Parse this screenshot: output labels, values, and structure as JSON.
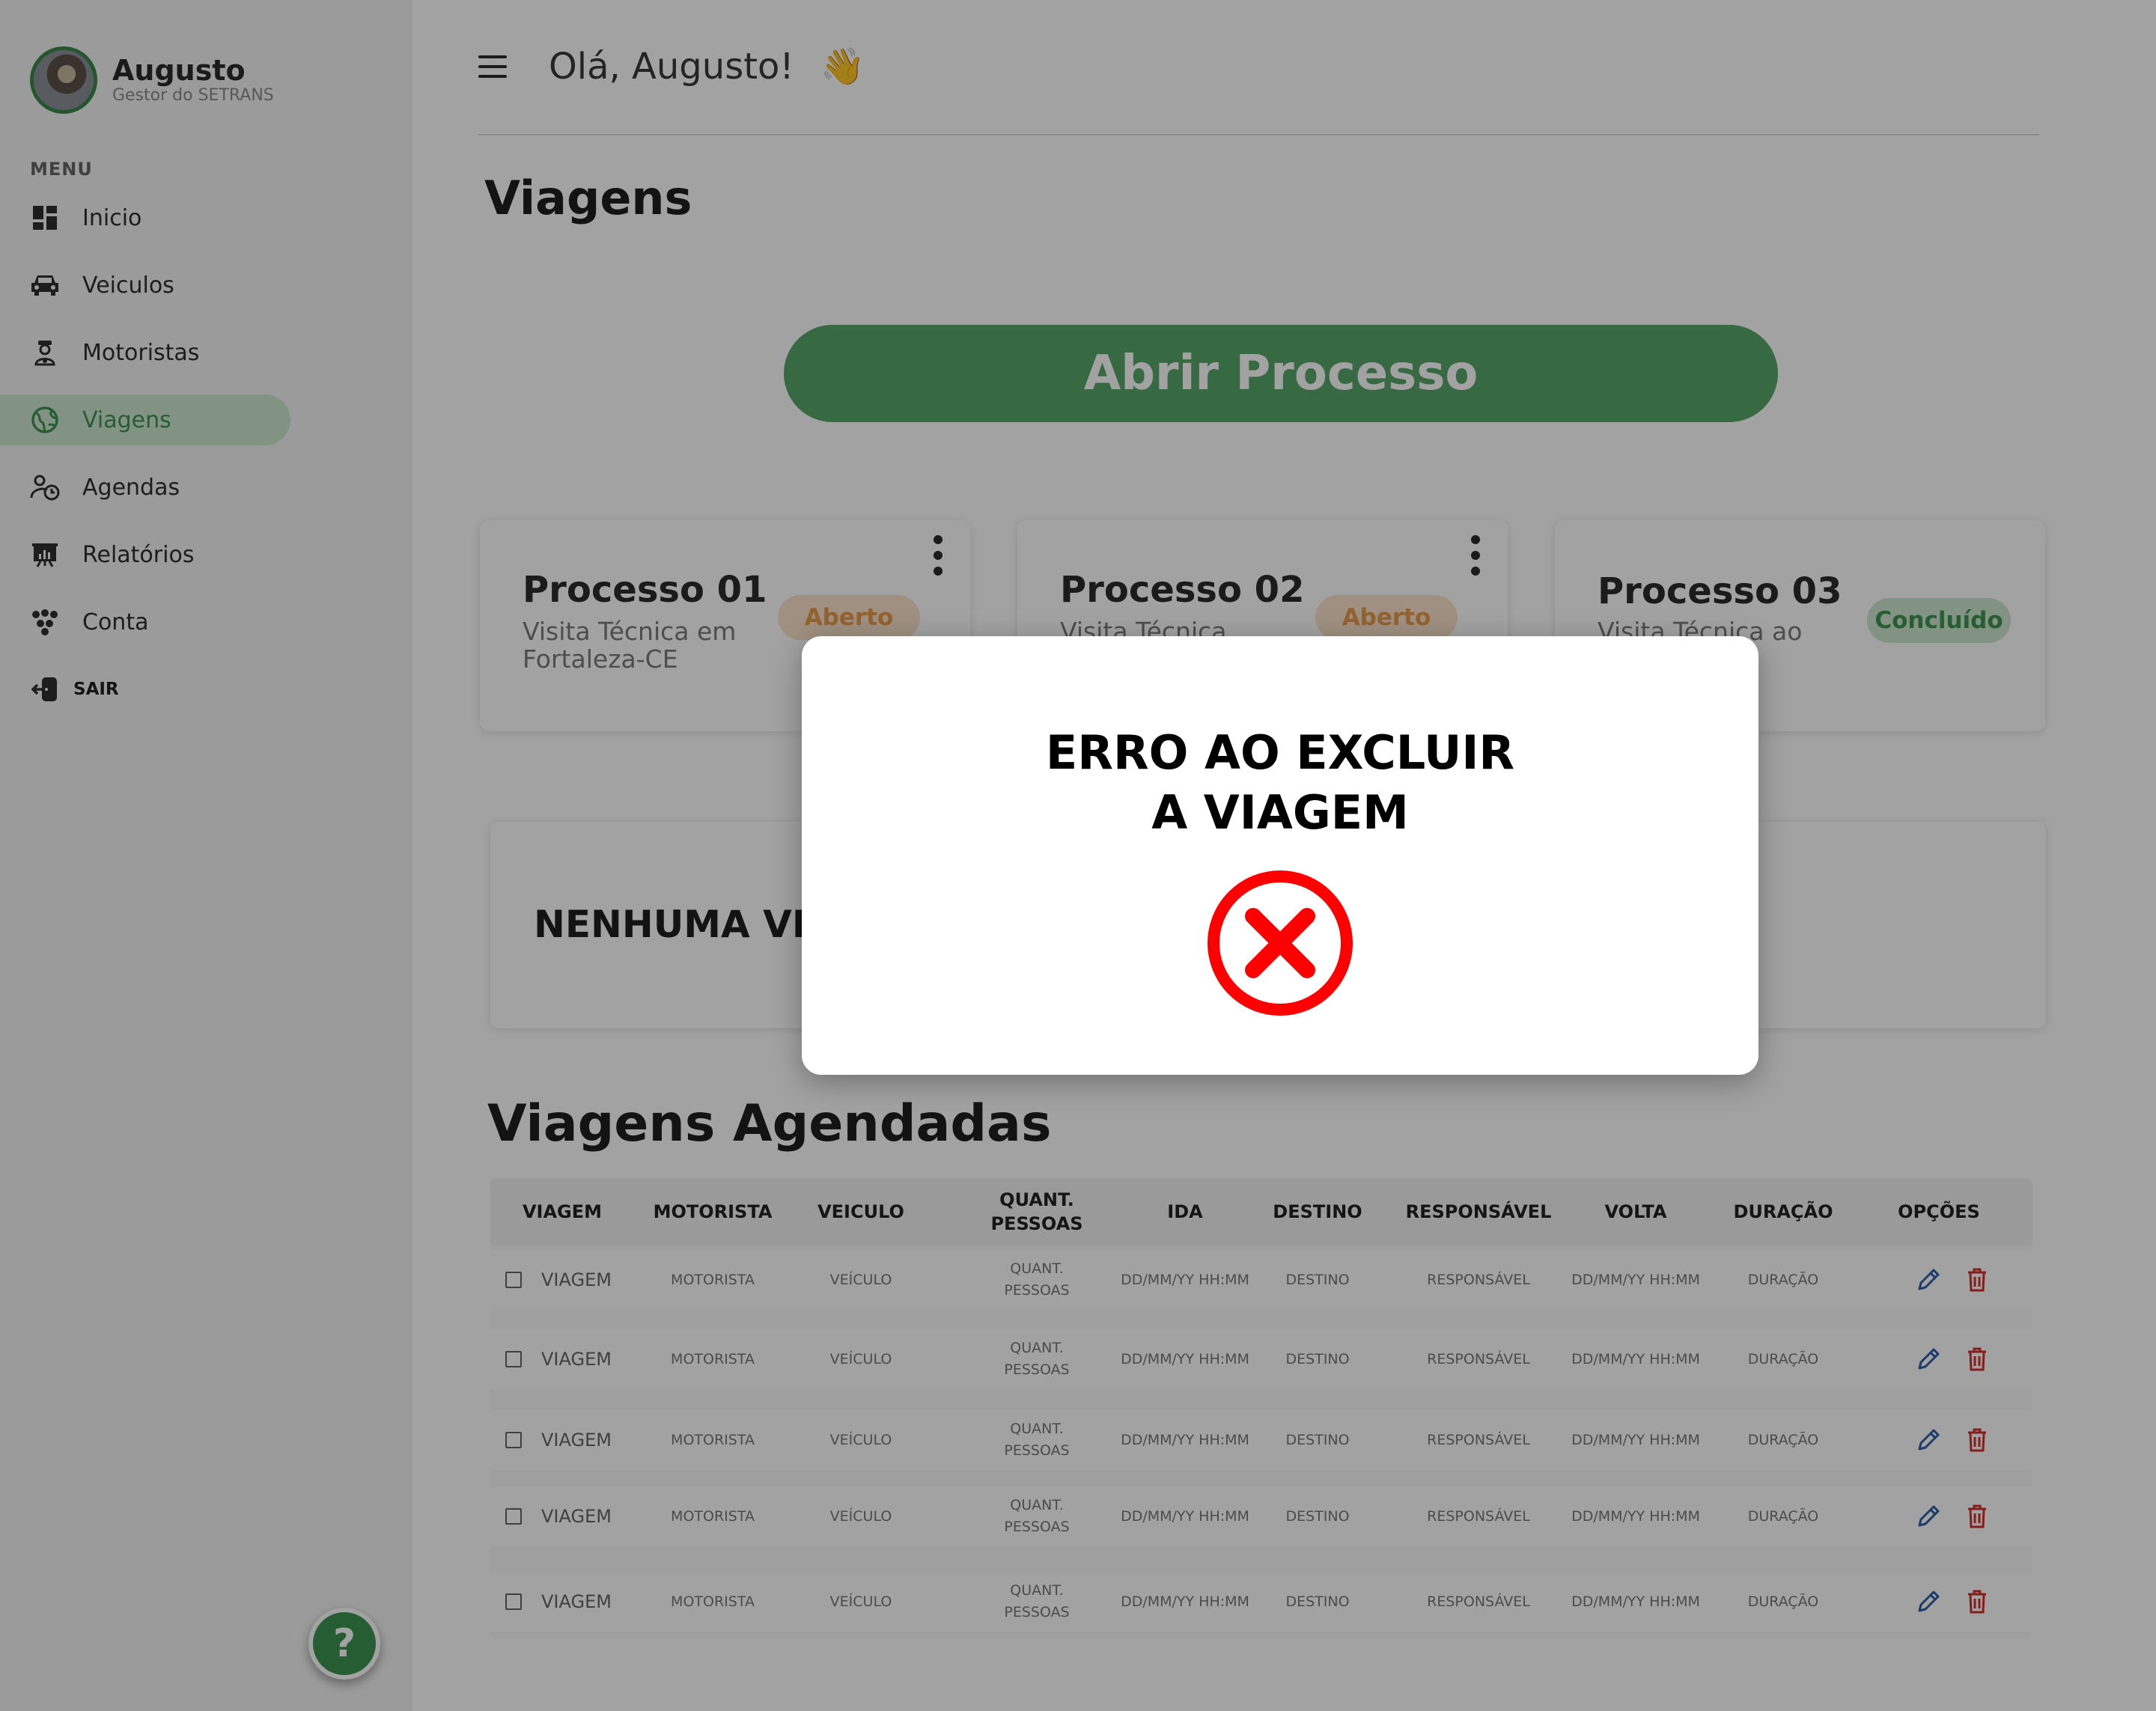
{
  "user": {
    "name": "Augusto",
    "role": "Gestor do SETRANS"
  },
  "menu": {
    "title": "MENU",
    "items": [
      {
        "label": "Inicio",
        "icon": "dashboard-icon"
      },
      {
        "label": "Veiculos",
        "icon": "car-icon"
      },
      {
        "label": "Motoristas",
        "icon": "driver-icon"
      },
      {
        "label": "Viagens",
        "icon": "globe-icon",
        "active": true
      },
      {
        "label": "Agendas",
        "icon": "agenda-icon"
      },
      {
        "label": "Relatórios",
        "icon": "report-icon"
      },
      {
        "label": "Conta",
        "icon": "account-icon"
      },
      {
        "label": "SAIR",
        "icon": "logout-icon"
      }
    ]
  },
  "help": {
    "label": "?"
  },
  "header": {
    "greeting": "Olá, Augusto!",
    "emoji": "👋"
  },
  "page": {
    "title": "Viagens",
    "open_button": "Abrir Processo"
  },
  "processes": [
    {
      "title": "Processo 01",
      "desc": "Visita Técnica em Fortaleza-CE",
      "status": "Aberto"
    },
    {
      "title": "Processo 02",
      "desc": "Visita Técnica",
      "status": "Aberto"
    },
    {
      "title": "Processo 03",
      "desc": "Visita Técnica ao RN",
      "status": "Concluído"
    }
  ],
  "empty_message": "NENHUMA VIAG",
  "scheduled": {
    "title": "Viagens Agendadas",
    "headers": [
      "VIAGEM",
      "MOTORISTA",
      "VEICULO",
      "QUANT. PESSOAS",
      "IDA",
      "DESTINO",
      "RESPONSÁVEL",
      "VOLTA",
      "DURAÇÃO",
      "OPÇÕES"
    ],
    "rows": [
      [
        "VIAGEM",
        "MOTORISTA",
        "VEÍCULO",
        "QUANT. PESSOAS",
        "DD/MM/YY HH:MM",
        "DESTINO",
        "RESPONSÁVEL",
        "DD/MM/YY HH:MM",
        "DURAÇÃO"
      ],
      [
        "VIAGEM",
        "MOTORISTA",
        "VEÍCULO",
        "QUANT. PESSOAS",
        "DD/MM/YY HH:MM",
        "DESTINO",
        "RESPONSÁVEL",
        "DD/MM/YY HH:MM",
        "DURAÇÃO"
      ],
      [
        "VIAGEM",
        "MOTORISTA",
        "VEÍCULO",
        "QUANT. PESSOAS",
        "DD/MM/YY HH:MM",
        "DESTINO",
        "RESPONSÁVEL",
        "DD/MM/YY HH:MM",
        "DURAÇÃO"
      ],
      [
        "VIAGEM",
        "MOTORISTA",
        "VEÍCULO",
        "QUANT. PESSOAS",
        "DD/MM/YY HH:MM",
        "DESTINO",
        "RESPONSÁVEL",
        "DD/MM/YY HH:MM",
        "DURAÇÃO"
      ],
      [
        "VIAGEM",
        "MOTORISTA",
        "VEÍCULO",
        "QUANT. PESSOAS",
        "DD/MM/YY HH:MM",
        "DESTINO",
        "RESPONSÁVEL",
        "DD/MM/YY HH:MM",
        "DURAÇÃO"
      ]
    ]
  },
  "modal": {
    "title": "ERRO AO EXCLUIR A VIAGEM",
    "icon": "error-x-circle-icon"
  },
  "colors": {
    "accent_green": "#3e9350",
    "button_green": "#57a86a",
    "badge_orange": "#e79a4a",
    "error_red": "#ff0000",
    "edit_blue": "#2b5ea8",
    "delete_red": "#d32f2f"
  }
}
